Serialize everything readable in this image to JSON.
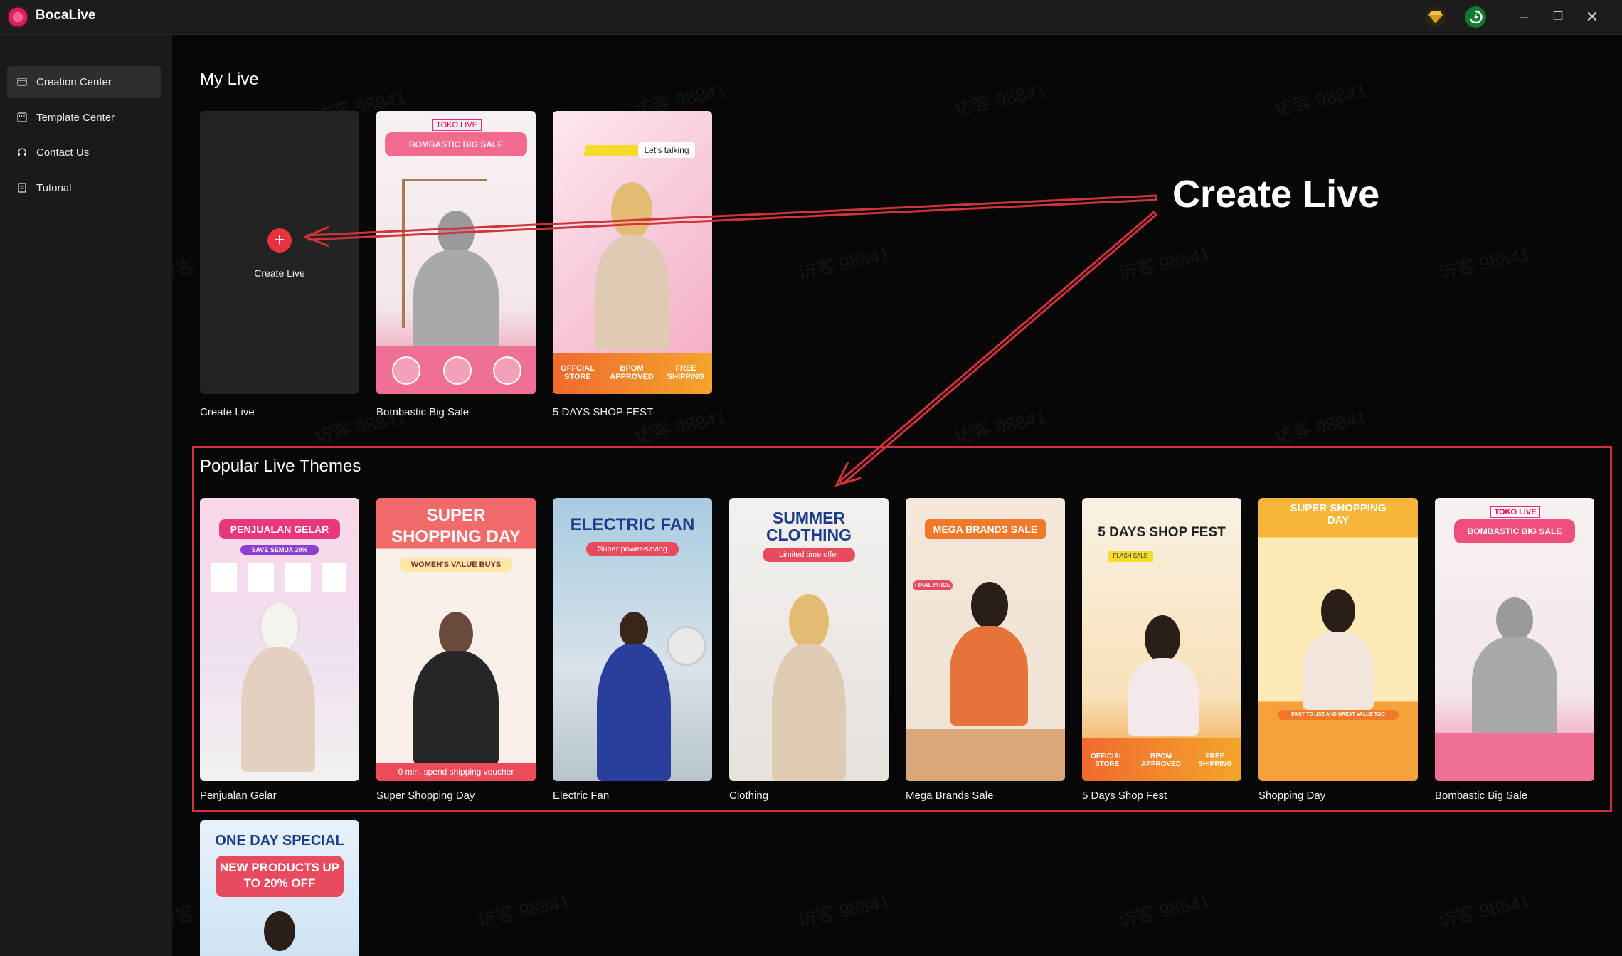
{
  "app": {
    "title": "BocaLive"
  },
  "sidebar": {
    "items": [
      {
        "label": "Creation Center",
        "icon": "folder-icon",
        "active": true
      },
      {
        "label": "Template Center",
        "icon": "template-icon",
        "active": false
      },
      {
        "label": "Contact Us",
        "icon": "headset-icon",
        "active": false
      },
      {
        "label": "Tutorial",
        "icon": "document-icon",
        "active": false
      }
    ]
  },
  "my_live": {
    "title": "My Live",
    "create_button": "Create Live",
    "cards": [
      {
        "label": "Create Live"
      },
      {
        "label": "Bombastic Big Sale",
        "tag": "TOKO LIVE",
        "banner": "BOMBASTIC BIG SALE"
      },
      {
        "label": "5 DAYS SHOP FEST",
        "bubble": "Let's talking",
        "footer": [
          "OFFCIAL STORE",
          "BPOM APPROVED",
          "FREE SHIPPING"
        ]
      }
    ]
  },
  "popular": {
    "title": "Popular Live Themes",
    "themes": [
      {
        "label": "Penjualan Gelar",
        "banner": "PENJUALAN GELAR",
        "sub": "SAVE SEMUA 20%"
      },
      {
        "label": "Super Shopping Day",
        "banner": "SUPER SHOPPING DAY",
        "sub": "WOMEN'S VALUE BUYS",
        "footer": "0 min. spend shipping voucher"
      },
      {
        "label": "Electric Fan",
        "banner": "ELECTRIC FAN",
        "sub": "Super power-saving"
      },
      {
        "label": "Clothing",
        "banner": "SUMMER CLOTHING",
        "sub": "Limited time offer"
      },
      {
        "label": "Mega Brands Sale",
        "banner": "MEGA BRANDS SALE",
        "sub": "FINAL PRICE"
      },
      {
        "label": "5 Days Shop Fest",
        "banner": "5 DAYS SHOP FEST",
        "sub": "FLASH SALE",
        "footer": [
          "OFFICIAL STORE",
          "BPOM APPROVED",
          "FREE SHIPPING"
        ]
      },
      {
        "label": "Shopping Day",
        "banner": "SUPER SHOPPING DAY",
        "sub": "EASY TO USE AND GREAT VALUE TOO"
      },
      {
        "label": "Bombastic Big Sale",
        "tag": "TOKO LIVE",
        "banner": "BOMBASTIC BIG SALE"
      }
    ],
    "extra": [
      {
        "banner": "ONE DAY SPECIAL",
        "sub": "NEW PRODUCTS UP TO 20% OFF"
      }
    ]
  },
  "annotation": {
    "text": "Create Live",
    "color": "#d0343b"
  },
  "watermark": "访客 98841",
  "colors": {
    "accent": "#e8323f",
    "background": "#070707",
    "sidebar": "#1a1a1a"
  }
}
